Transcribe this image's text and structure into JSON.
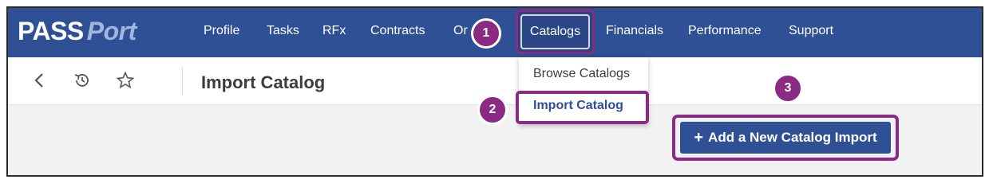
{
  "brand": {
    "part1": "PASS",
    "part2": "Port"
  },
  "nav": {
    "items": [
      "Profile",
      "Tasks",
      "RFx",
      "Contracts",
      "Or"
    ],
    "active": "Catalogs",
    "after": [
      "Financials",
      "Performance",
      "Support"
    ]
  },
  "toolbar": {
    "back_icon": "chevron-left-icon",
    "history_icon": "history-icon",
    "favorite_icon": "star-icon"
  },
  "page": {
    "title": "Import Catalog"
  },
  "dropdown": {
    "items": [
      "Browse Catalogs",
      "Import Catalog"
    ]
  },
  "action": {
    "plus": "+",
    "label": "Add a New Catalog Import"
  },
  "steps": [
    "1",
    "2",
    "3"
  ],
  "colors": {
    "nav_bg": "#2f5094",
    "highlight": "#8b2a83",
    "dropdown_active_text": "#2f5094"
  }
}
